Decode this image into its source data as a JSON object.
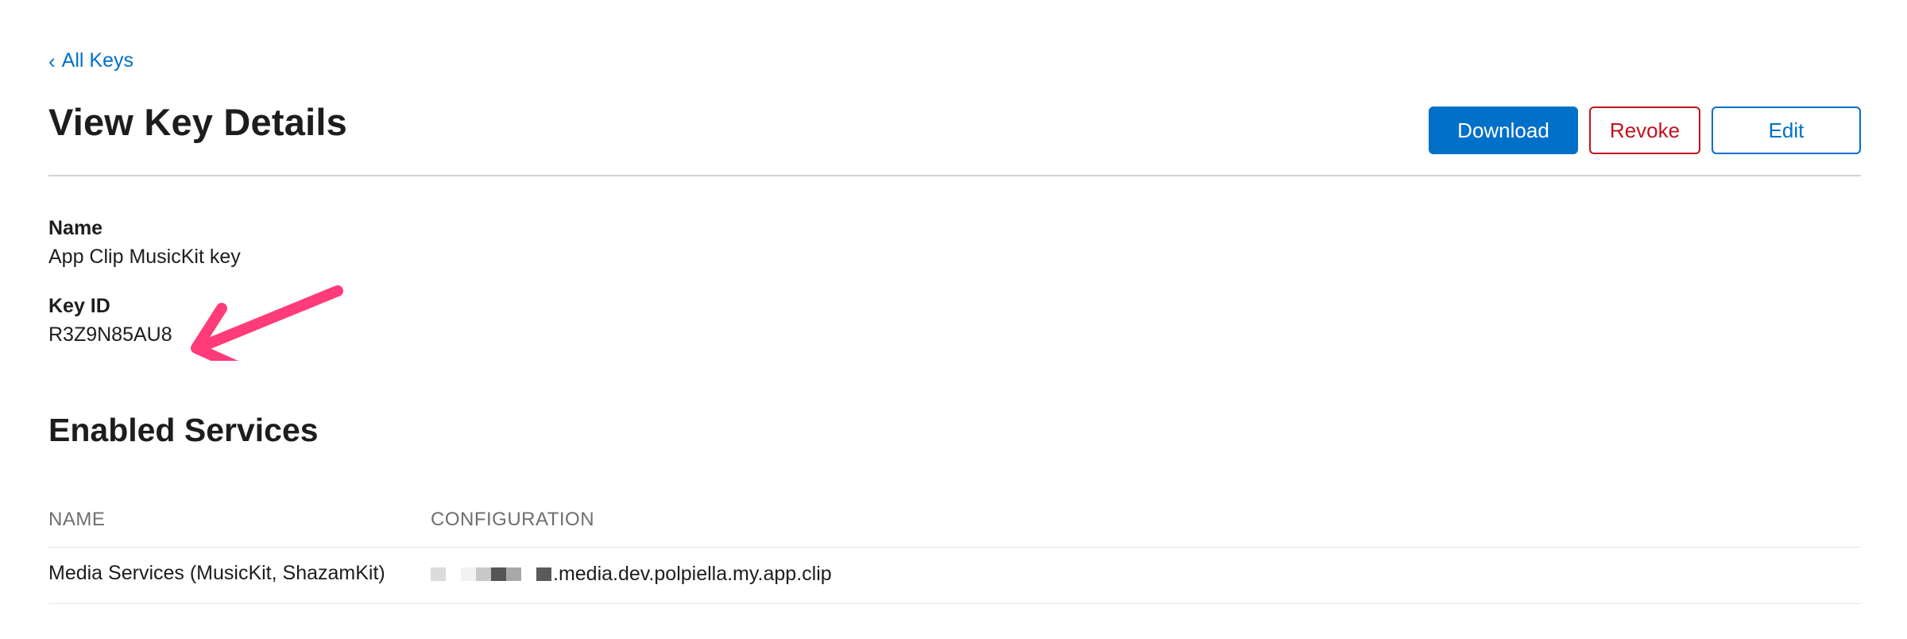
{
  "nav": {
    "back_label": "All Keys"
  },
  "header": {
    "title": "View Key Details",
    "buttons": {
      "download": "Download",
      "revoke": "Revoke",
      "edit": "Edit"
    }
  },
  "details": {
    "name_label": "Name",
    "name_value": "App Clip MusicKit key",
    "key_id_label": "Key ID",
    "key_id_value": "R3Z9N85AU8"
  },
  "services": {
    "title": "Enabled Services",
    "columns": {
      "name": "NAME",
      "configuration": "CONFIGURATION"
    },
    "rows": [
      {
        "name": "Media Services (MusicKit, ShazamKit)",
        "configuration": ".media.dev.polpiella.my.app.clip"
      }
    ]
  },
  "colors": {
    "accent": "#0070c9",
    "danger": "#c1121f",
    "annotation_arrow": "#ff3b7a"
  }
}
